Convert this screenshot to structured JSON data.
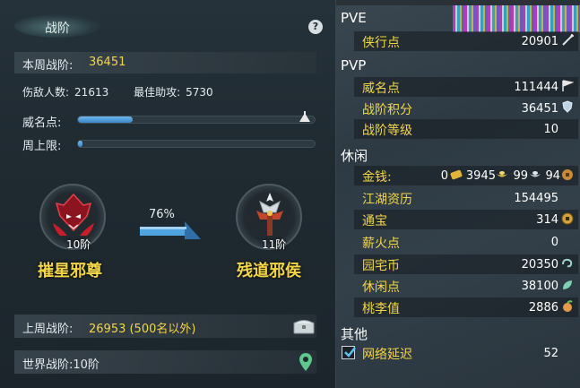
{
  "panel": {
    "title": "战阶",
    "help_label": "?",
    "week_score_label": "本周战阶:",
    "week_score_value": "36451",
    "kills_label": "伤敌人数:",
    "kills_value": "21613",
    "assist_label": "最佳助攻:",
    "assist_value": "5730",
    "reputation_label": "威名点:",
    "reputation_fraction": 0.23,
    "weekly_cap_label": "周上限:",
    "weekly_cap_fraction": 0.02,
    "current_rank_level": "10阶",
    "current_rank_name": "摧星邪尊",
    "next_rank_level": "11阶",
    "next_rank_name": "残道邪侯",
    "progress_percent": "76%",
    "last_week_label": "上周战阶:",
    "last_week_value": "26953 (500名以外)",
    "world_label": "世界战阶:",
    "world_value": "10阶"
  },
  "stats": {
    "pve_label": "PVE",
    "xingxia_label": "侠行点",
    "xingxia_value": "20901",
    "pvp_label": "PVP",
    "weiming_label": "威名点",
    "weiming_value": "111444",
    "zhanjie_points_label": "战阶积分",
    "zhanjie_points_value": "36451",
    "zhanjie_level_label": "战阶等级",
    "zhanjie_level_value": "10",
    "leisure_label": "休闲",
    "money_label": "金钱:",
    "money_a": "0",
    "money_b": "3945",
    "money_c": "99",
    "money_d": "94",
    "jianghu_label": "江湖资历",
    "jianghu_value": "154495",
    "tongbao_label": "通宝",
    "tongbao_value": "314",
    "xinhuo_label": "薪火点",
    "xinhuo_value": "0",
    "yuanzhai_label": "园宅币",
    "yuanzhai_value": "20350",
    "xiuxian_label": "休闲点",
    "xiuxian_value": "38100",
    "taoli_label": "桃李值",
    "taoli_value": "2886",
    "other_label": "其他",
    "network_label": "网络延迟",
    "network_value": "52"
  }
}
